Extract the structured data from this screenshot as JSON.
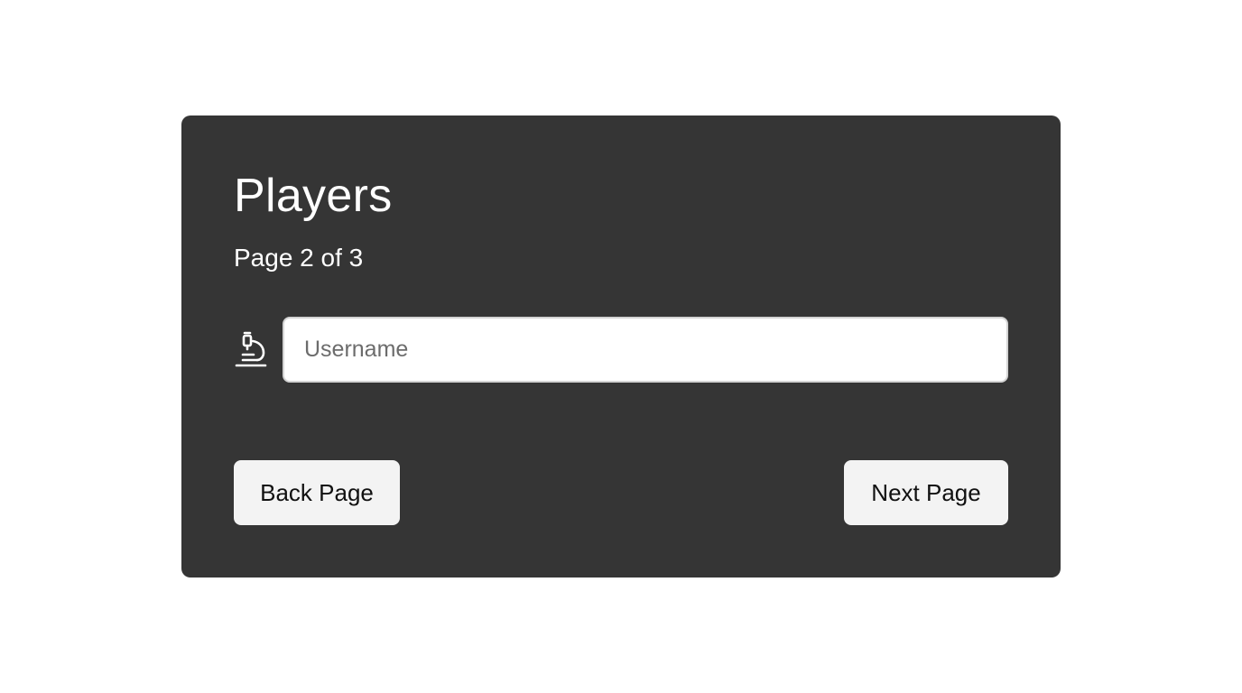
{
  "card": {
    "title": "Players",
    "subtitle": "Page 2 of 3"
  },
  "search": {
    "icon": "microscope-icon",
    "placeholder": "Username",
    "value": ""
  },
  "pagination": {
    "back_label": "Back Page",
    "next_label": "Next Page"
  },
  "colors": {
    "card_background": "#353535",
    "page_background": "#ffffff",
    "button_background": "#f3f3f3",
    "text_on_card": "#ffffff"
  }
}
